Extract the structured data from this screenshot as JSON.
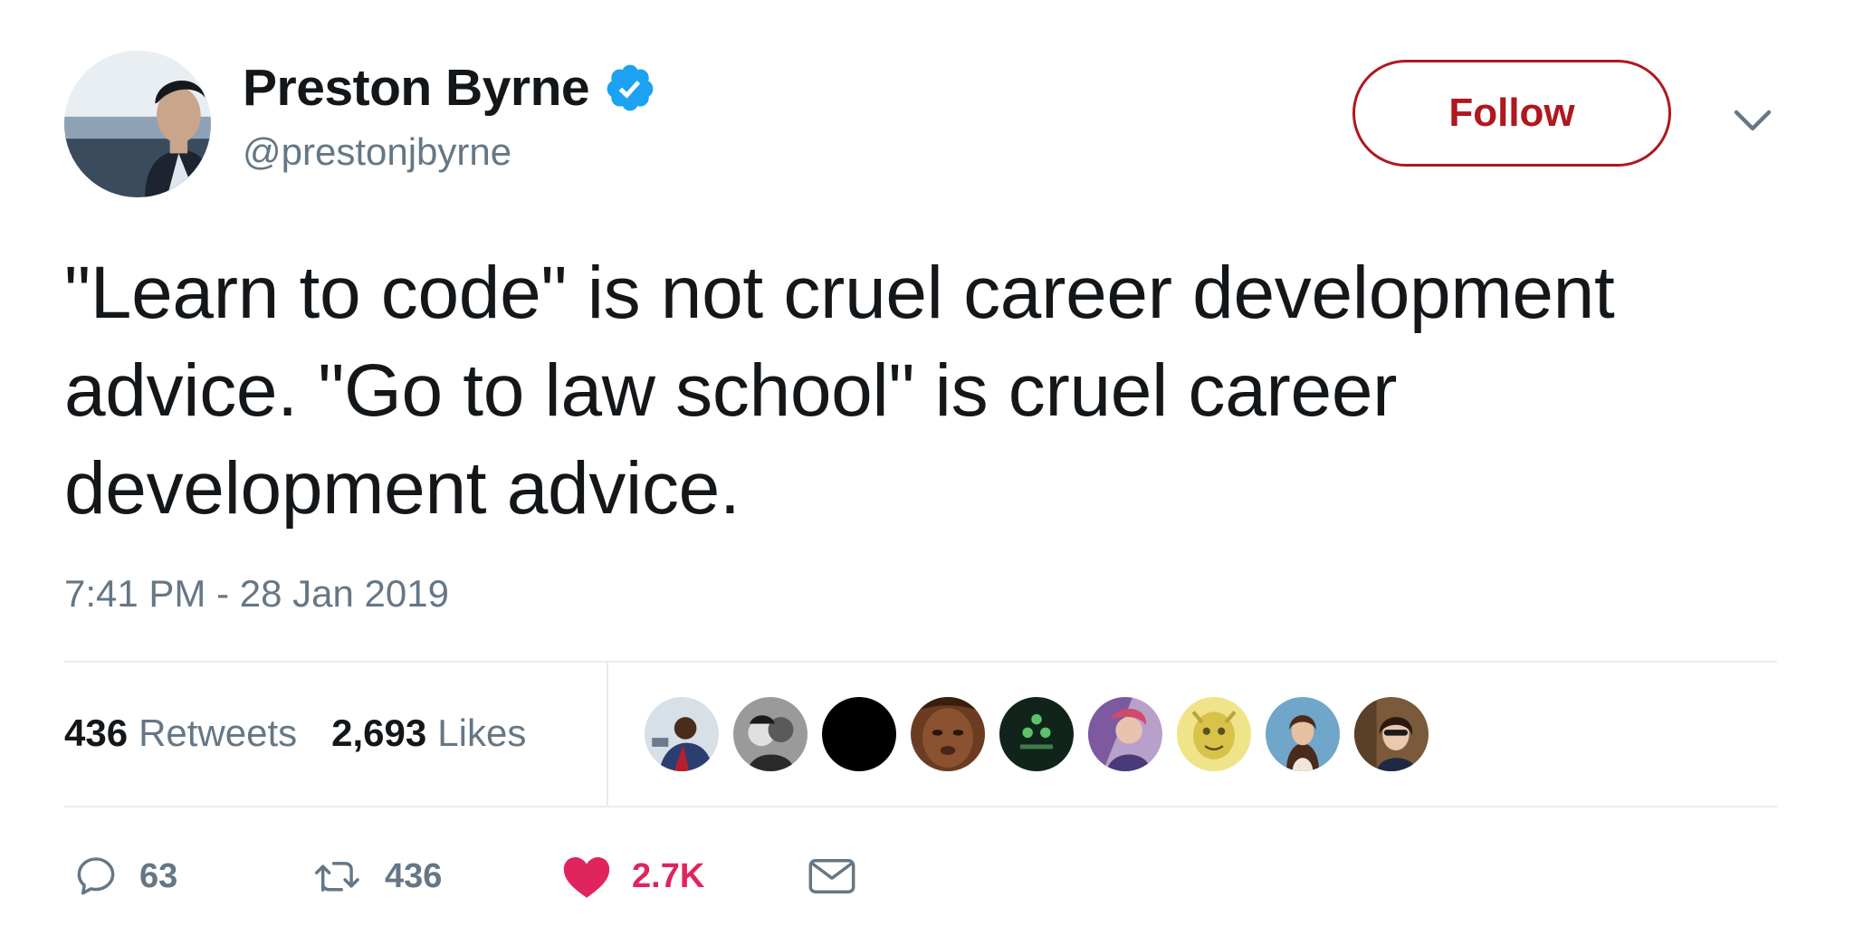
{
  "author": {
    "display_name": "Preston Byrne",
    "handle": "@prestonjbyrne",
    "verified": true,
    "avatar_icon": "profile-photo"
  },
  "header": {
    "follow_label": "Follow",
    "menu_icon": "chevron-down-icon"
  },
  "tweet": {
    "text": "\"Learn to code\" is not cruel career development advice. \"Go to law school\" is cruel career development advice.",
    "timestamp": "7:41 PM - 28 Jan 2019"
  },
  "stats": {
    "retweets": {
      "count": "436",
      "label": "Retweets"
    },
    "likes": {
      "count": "2,693",
      "label": "Likes"
    }
  },
  "likers": [
    {
      "icon": "liker-avatar-1"
    },
    {
      "icon": "liker-avatar-2"
    },
    {
      "icon": "liker-avatar-3"
    },
    {
      "icon": "liker-avatar-4"
    },
    {
      "icon": "liker-avatar-5"
    },
    {
      "icon": "liker-avatar-6"
    },
    {
      "icon": "liker-avatar-7"
    },
    {
      "icon": "liker-avatar-8"
    },
    {
      "icon": "liker-avatar-9"
    }
  ],
  "actions": {
    "reply": {
      "icon": "reply-icon",
      "count": "63"
    },
    "retweet": {
      "icon": "retweet-icon",
      "count": "436"
    },
    "like": {
      "icon": "heart-icon",
      "count": "2.7K"
    },
    "dm": {
      "icon": "envelope-icon"
    }
  },
  "colors": {
    "follow_accent": "#b0171f",
    "verified_blue": "#1da1f2",
    "like_pink": "#e0245e",
    "muted_gray": "#657786",
    "text_dark": "#14171a"
  }
}
